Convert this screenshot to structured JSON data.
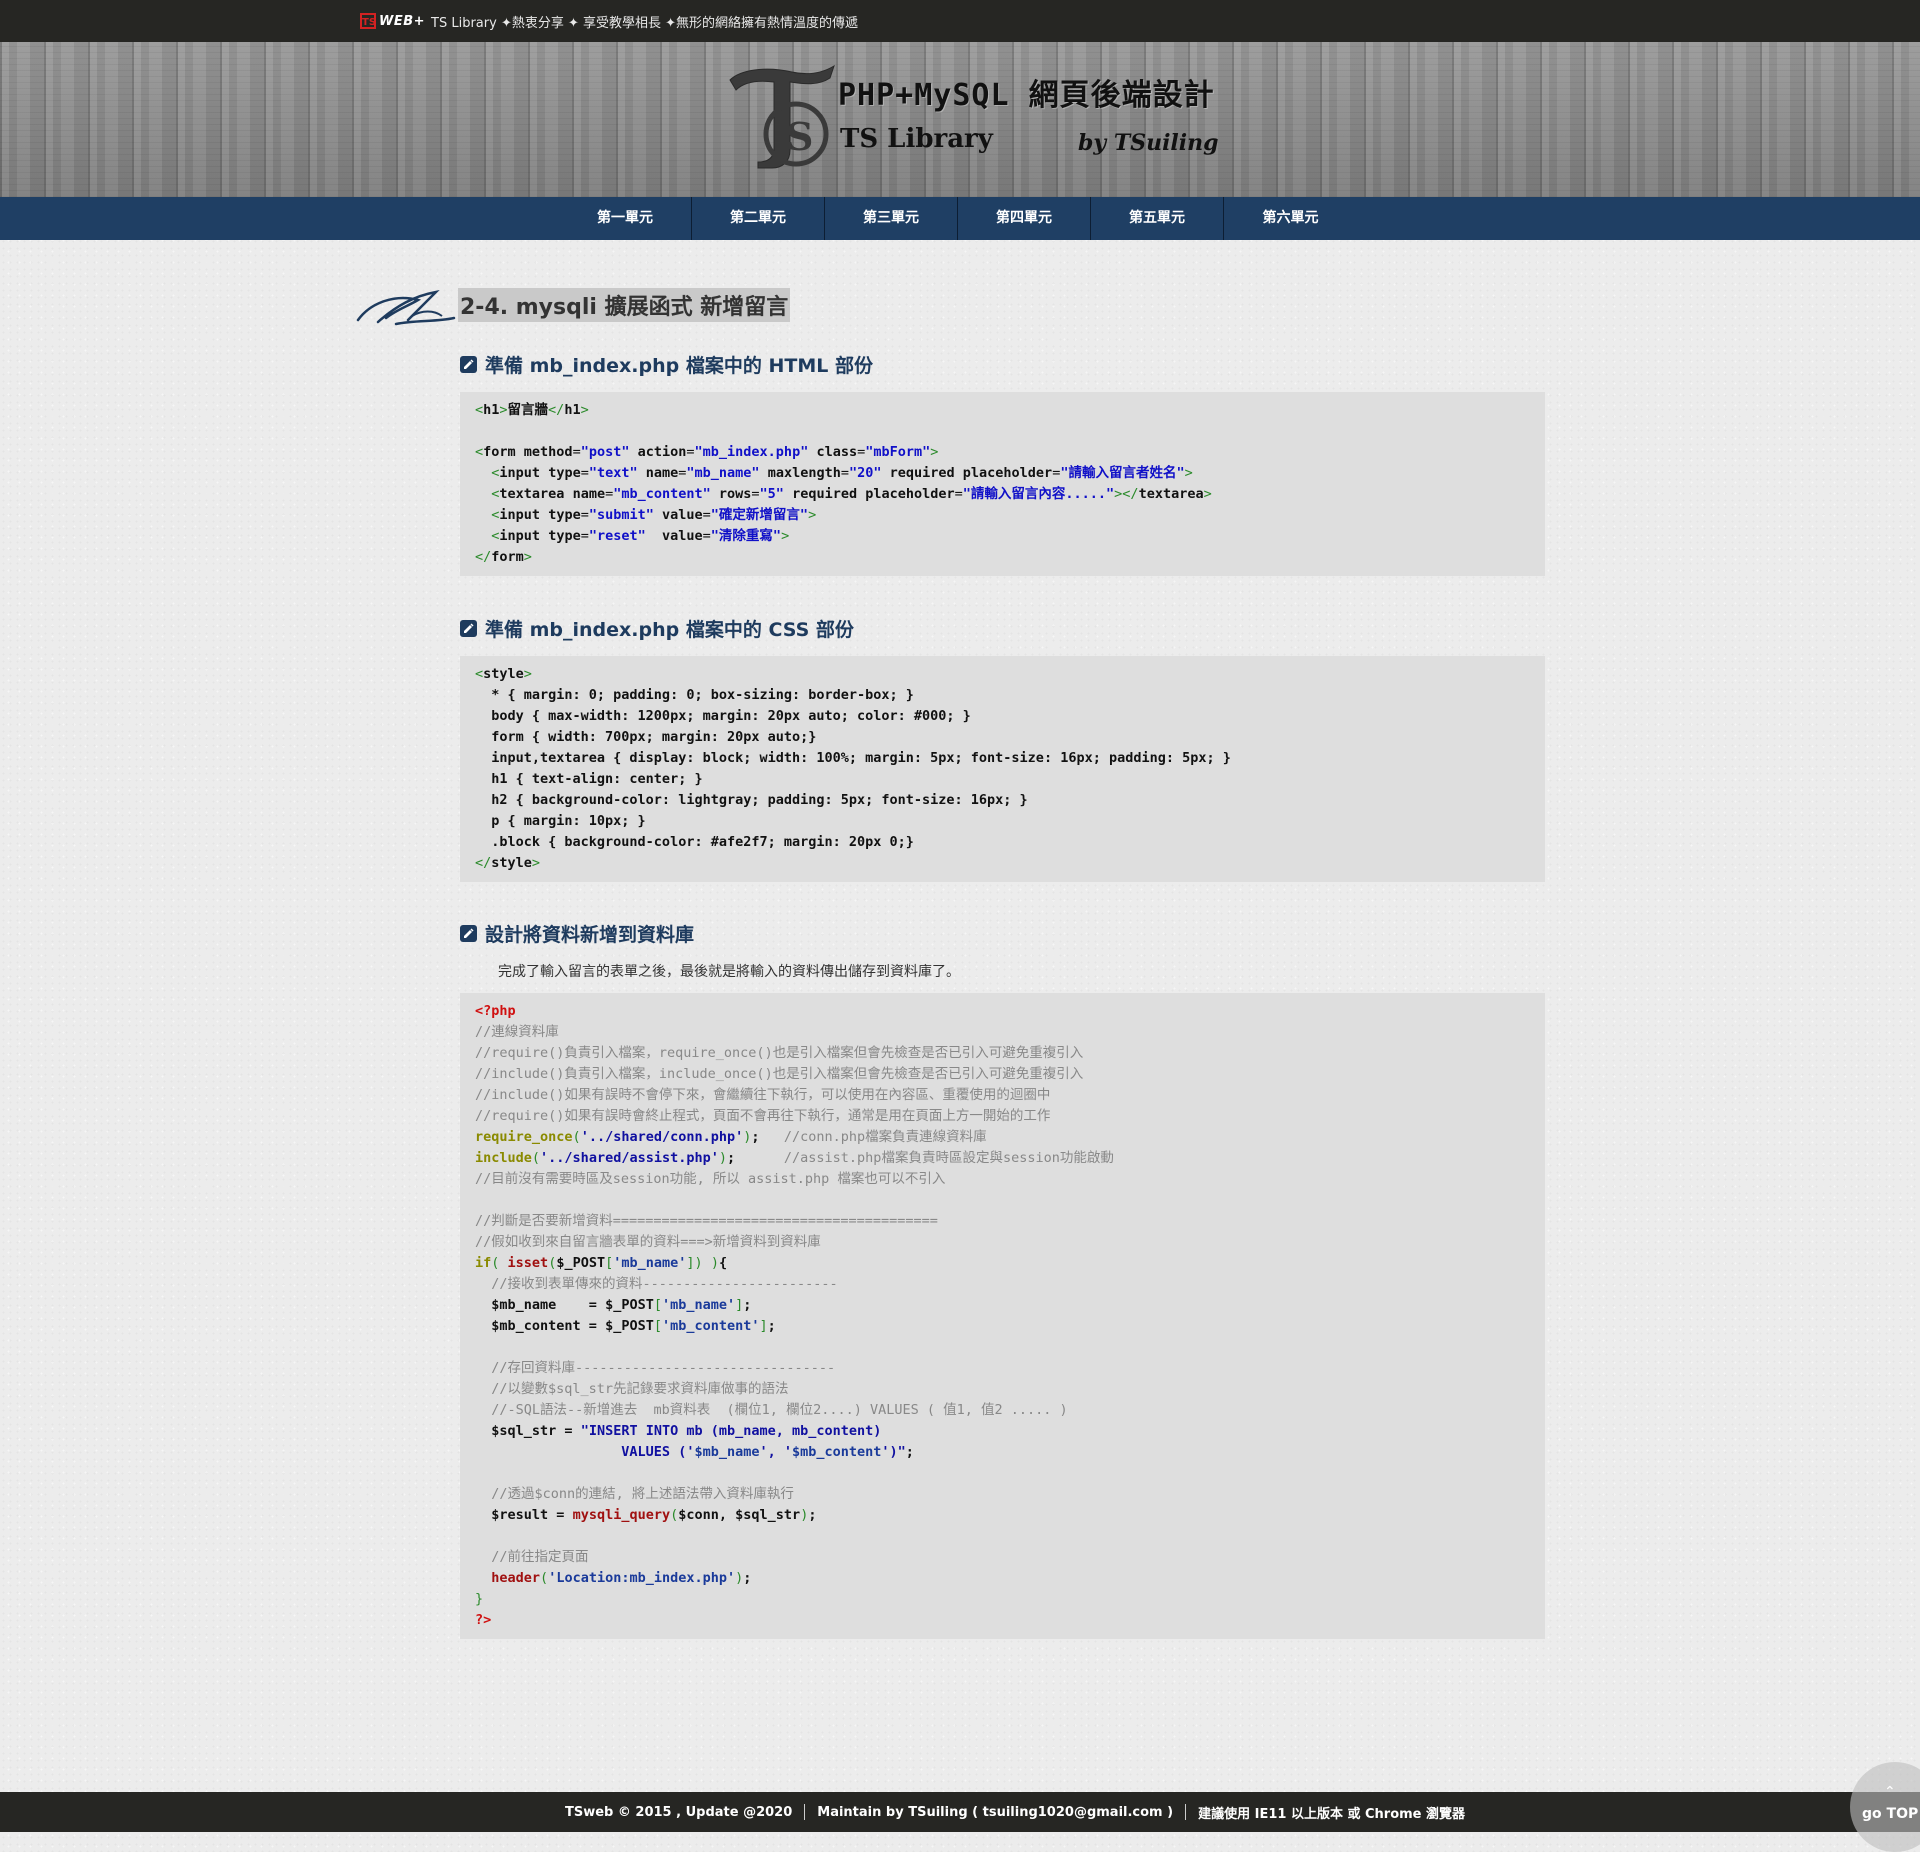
{
  "topbar": {
    "brand_ts": "TS",
    "brand_web": "WEB+",
    "tagline": "TS Library ✦熱衷分享 ✦ 享受教學相長 ✦無形的網絡擁有熱情溫度的傳遞"
  },
  "banner": {
    "title": "PHP+MySQL 網頁後端設計",
    "subtitle": "TS Library",
    "byline": "by TSuiling"
  },
  "nav": {
    "items": [
      "第一單元",
      "第二單元",
      "第三單元",
      "第四單元",
      "第五單元",
      "第六單元"
    ]
  },
  "page_title": "2-4. mysqli 擴展函式 新增留言",
  "sections": [
    {
      "heading": "準備 mb_index.php 檔案中的 HTML 部份"
    },
    {
      "heading": "準備 mb_index.php 檔案中的 CSS 部份"
    },
    {
      "heading": "設計將資料新增到資料庫"
    }
  ],
  "note": "完成了輸入留言的表單之後，最後就是將輸入的資料傳出儲存到資料庫了。",
  "code_html": [
    [
      [
        "br",
        "<"
      ],
      [
        "tag",
        "h1"
      ],
      [
        "br",
        ">"
      ],
      [
        "txt",
        "留言牆"
      ],
      [
        "br",
        "</"
      ],
      [
        "tag",
        "h1"
      ],
      [
        "br",
        ">"
      ]
    ],
    [],
    [
      [
        "br",
        "<"
      ],
      [
        "tag",
        "form "
      ],
      [
        "at",
        "method"
      ],
      [
        "eq",
        "="
      ],
      [
        "val",
        "\"post\""
      ],
      [
        "at",
        " action"
      ],
      [
        "eq",
        "="
      ],
      [
        "val",
        "\"mb_index.php\""
      ],
      [
        "at",
        " class"
      ],
      [
        "eq",
        "="
      ],
      [
        "val",
        "\"mbForm\""
      ],
      [
        "br",
        ">"
      ]
    ],
    [
      [
        "pl",
        "  "
      ],
      [
        "br",
        "<"
      ],
      [
        "tag",
        "input "
      ],
      [
        "at",
        "type"
      ],
      [
        "eq",
        "="
      ],
      [
        "val",
        "\"text\""
      ],
      [
        "at",
        " name"
      ],
      [
        "eq",
        "="
      ],
      [
        "val",
        "\"mb_name\""
      ],
      [
        "at",
        " maxlength"
      ],
      [
        "eq",
        "="
      ],
      [
        "val",
        "\"20\""
      ],
      [
        "at",
        " required placeholder"
      ],
      [
        "eq",
        "="
      ],
      [
        "val",
        "\"請輸入留言者姓名\""
      ],
      [
        "br",
        ">"
      ]
    ],
    [
      [
        "pl",
        "  "
      ],
      [
        "br",
        "<"
      ],
      [
        "tag",
        "textarea "
      ],
      [
        "at",
        "name"
      ],
      [
        "eq",
        "="
      ],
      [
        "val",
        "\"mb_content\""
      ],
      [
        "at",
        " rows"
      ],
      [
        "eq",
        "="
      ],
      [
        "val",
        "\"5\""
      ],
      [
        "at",
        " required placeholder"
      ],
      [
        "eq",
        "="
      ],
      [
        "val",
        "\"請輸入留言內容.....\""
      ],
      [
        "br",
        "></"
      ],
      [
        "tag",
        "textarea"
      ],
      [
        "br",
        ">"
      ]
    ],
    [
      [
        "pl",
        "  "
      ],
      [
        "br",
        "<"
      ],
      [
        "tag",
        "input "
      ],
      [
        "at",
        "type"
      ],
      [
        "eq",
        "="
      ],
      [
        "val",
        "\"submit\""
      ],
      [
        "at",
        " value"
      ],
      [
        "eq",
        "="
      ],
      [
        "val",
        "\"確定新增留言\""
      ],
      [
        "br",
        ">"
      ]
    ],
    [
      [
        "pl",
        "  "
      ],
      [
        "br",
        "<"
      ],
      [
        "tag",
        "input "
      ],
      [
        "at",
        "type"
      ],
      [
        "eq",
        "="
      ],
      [
        "val",
        "\"reset\""
      ],
      [
        "at",
        "  value"
      ],
      [
        "eq",
        "="
      ],
      [
        "val",
        "\"清除重寫\""
      ],
      [
        "br",
        ">"
      ]
    ],
    [
      [
        "br",
        "</"
      ],
      [
        "tag",
        "form"
      ],
      [
        "br",
        ">"
      ]
    ]
  ],
  "code_css": [
    [
      [
        "br",
        "<"
      ],
      [
        "tag",
        "style"
      ],
      [
        "br",
        ">"
      ]
    ],
    [
      [
        "pl",
        "  * { margin: 0; padding: 0; box-sizing: border-box; }"
      ]
    ],
    [
      [
        "pl",
        "  body { max-width: 1200px; margin: 20px auto; color: #000; }"
      ]
    ],
    [
      [
        "pl",
        "  form { width: 700px; margin: 20px auto;}"
      ]
    ],
    [
      [
        "pl",
        "  input,textarea { display: block; width: 100%; margin: 5px; font-size: 16px; padding: 5px; }"
      ]
    ],
    [
      [
        "pl",
        "  h1 { text-align: center; }"
      ]
    ],
    [
      [
        "pl",
        "  h2 { background-color: lightgray; padding: 5px; font-size: 16px; }"
      ]
    ],
    [
      [
        "pl",
        "  p { margin: 10px; }"
      ]
    ],
    [
      [
        "pl",
        "  .block { background-color: #afe2f7; margin: 20px 0;}"
      ]
    ],
    [
      [
        "br",
        "</"
      ],
      [
        "tag",
        "style"
      ],
      [
        "br",
        ">"
      ]
    ]
  ],
  "code_php": [
    [
      [
        "php",
        "<?php"
      ]
    ],
    [
      [
        "cm",
        "//連線資料庫"
      ]
    ],
    [
      [
        "cm",
        "//require()負責引入檔案，require_once()也是引入檔案但會先檢查是否已引入可避免重複引入"
      ]
    ],
    [
      [
        "cm",
        "//include()負責引入檔案，include_once()也是引入檔案但會先檢查是否已引入可避免重複引入"
      ]
    ],
    [
      [
        "cm",
        "//include()如果有誤時不會停下來，會繼續往下執行，可以使用在內容區、重覆使用的迴圈中"
      ]
    ],
    [
      [
        "cm",
        "//require()如果有誤時會終止程式，頁面不會再往下執行，通常是用在頁面上方一開始的工作"
      ]
    ],
    [
      [
        "kw",
        "require_once"
      ],
      [
        "br",
        "("
      ],
      [
        "str",
        "'../shared/conn.php'"
      ],
      [
        "br",
        ")"
      ],
      [
        "pl",
        ";   "
      ],
      [
        "cm",
        "//conn.php檔案負責連線資料庫"
      ]
    ],
    [
      [
        "kw",
        "include"
      ],
      [
        "br",
        "("
      ],
      [
        "str",
        "'../shared/assist.php'"
      ],
      [
        "br",
        ")"
      ],
      [
        "pl",
        ";      "
      ],
      [
        "cm",
        "//assist.php檔案負責時區設定與session功能啟動"
      ]
    ],
    [
      [
        "cm",
        "//目前沒有需要時區及session功能, 所以 assist.php 檔案也可以不引入"
      ]
    ],
    [],
    [
      [
        "cm",
        "//判斷是否要新增資料========================================"
      ]
    ],
    [
      [
        "cm",
        "//假如收到來自留言牆表單的資料===>新增資料到資料庫"
      ]
    ],
    [
      [
        "kw",
        "if"
      ],
      [
        "br",
        "("
      ],
      [
        "pl",
        " "
      ],
      [
        "fn",
        "isset"
      ],
      [
        "br",
        "("
      ],
      [
        "var",
        "$_POST"
      ],
      [
        "br",
        "["
      ],
      [
        "sstr",
        "'mb_name'"
      ],
      [
        "br",
        "]"
      ],
      [
        "br",
        ")"
      ],
      [
        "pl",
        " "
      ],
      [
        "br",
        ")"
      ],
      [
        "pl",
        "{"
      ]
    ],
    [
      [
        "pl",
        "  "
      ],
      [
        "cm",
        "//接收到表單傳來的資料------------------------"
      ]
    ],
    [
      [
        "pl",
        "  "
      ],
      [
        "var",
        "$mb_name"
      ],
      [
        "pl",
        "    = "
      ],
      [
        "var",
        "$_POST"
      ],
      [
        "br",
        "["
      ],
      [
        "sstr",
        "'mb_name'"
      ],
      [
        "br",
        "]"
      ],
      [
        "pl",
        ";"
      ]
    ],
    [
      [
        "pl",
        "  "
      ],
      [
        "var",
        "$mb_content"
      ],
      [
        "pl",
        " = "
      ],
      [
        "var",
        "$_POST"
      ],
      [
        "br",
        "["
      ],
      [
        "sstr",
        "'mb_content'"
      ],
      [
        "br",
        "]"
      ],
      [
        "pl",
        ";"
      ]
    ],
    [],
    [
      [
        "pl",
        "  "
      ],
      [
        "cm",
        "//存回資料庫--------------------------------"
      ]
    ],
    [
      [
        "pl",
        "  "
      ],
      [
        "cm",
        "//以變數$sql_str先記錄要求資料庫做事的語法"
      ]
    ],
    [
      [
        "pl",
        "  "
      ],
      [
        "cm",
        "//-SQL語法--新增進去  mb資料表  (欄位1, 欄位2....) VALUES ( 值1, 值2 ..... )"
      ]
    ],
    [
      [
        "pl",
        "  "
      ],
      [
        "var",
        "$sql_str"
      ],
      [
        "pl",
        " = "
      ],
      [
        "str",
        "\"INSERT INTO mb (mb_name, mb_content)"
      ]
    ],
    [
      [
        "str",
        "                  VALUES ('"
      ],
      [
        "sstr",
        "$mb_name"
      ],
      [
        "str",
        "', '"
      ],
      [
        "sstr",
        "$mb_content"
      ],
      [
        "str",
        "')\""
      ],
      [
        "pl",
        ";"
      ]
    ],
    [],
    [
      [
        "pl",
        "  "
      ],
      [
        "cm",
        "//透過$conn的連結, 將上述語法帶入資料庫執行"
      ]
    ],
    [
      [
        "pl",
        "  "
      ],
      [
        "var",
        "$result"
      ],
      [
        "pl",
        " = "
      ],
      [
        "fn",
        "mysqli_query"
      ],
      [
        "br",
        "("
      ],
      [
        "var",
        "$conn"
      ],
      [
        "pl",
        ", "
      ],
      [
        "var",
        "$sql_str"
      ],
      [
        "br",
        ")"
      ],
      [
        "pl",
        ";"
      ]
    ],
    [],
    [
      [
        "pl",
        "  "
      ],
      [
        "cm",
        "//前往指定頁面"
      ]
    ],
    [
      [
        "pl",
        "  "
      ],
      [
        "fn",
        "header"
      ],
      [
        "br",
        "("
      ],
      [
        "sstr",
        "'Location:mb_index.php'"
      ],
      [
        "br",
        ")"
      ],
      [
        "pl",
        ";"
      ]
    ],
    [
      [
        "br",
        "}"
      ]
    ],
    [
      [
        "php",
        "?>"
      ]
    ]
  ],
  "footer": {
    "copyright": "TSweb © 2015 , Update @2020",
    "maintain": "Maintain by TSuiling ( tsuiling1020@gmail.com )",
    "browser": "建議使用 IE11 以上版本 或 Chrome 瀏覽器"
  },
  "gotop": {
    "label": "go TOP",
    "arrow": "⌃"
  },
  "colors": {
    "nav_bg": "#1f3f64",
    "heading": "#1e3b5e",
    "code_bg": "#dedede",
    "topbar_bg": "#262623"
  }
}
